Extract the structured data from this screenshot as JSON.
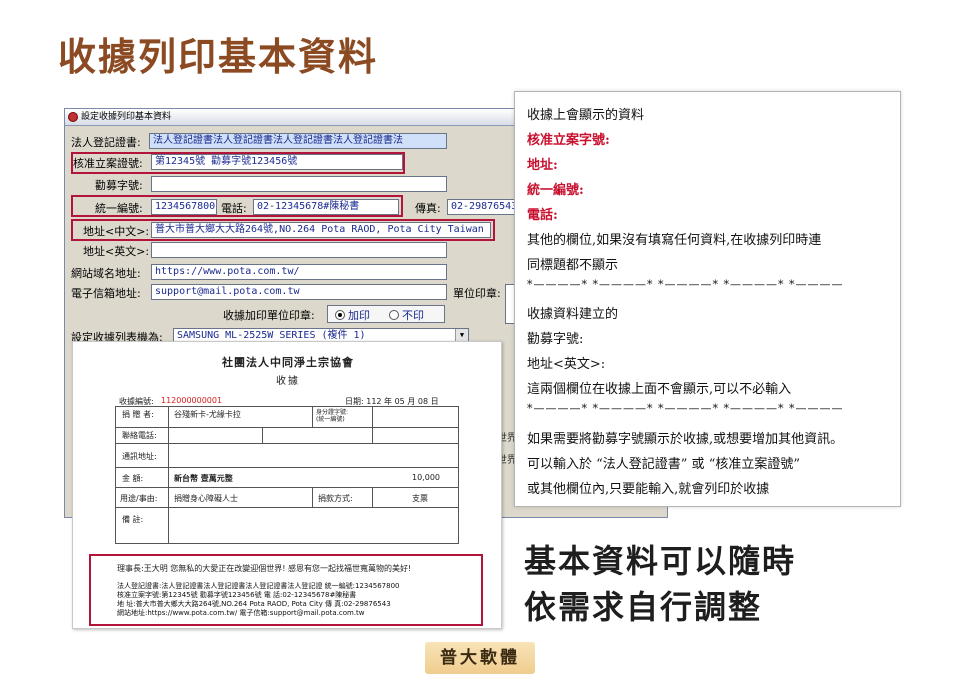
{
  "page": {
    "title": "收據列印基本資料"
  },
  "window": {
    "title": "設定收據列印基本資料",
    "labels": {
      "legal_cert": "法人登記證書:",
      "approval_no": "核准立案證號:",
      "fundraise_no": "勸募字號:",
      "tax_id": "統一編號:",
      "phone": "電話:",
      "fax": "傳真:",
      "address_zh": "地址<中文>:",
      "address_en": "地址<英文>:",
      "website": "網站域名地址:",
      "email": "電子信箱地址:",
      "unit_seal": "單位印章:",
      "seal_option": "收據加印單位印章:",
      "printer": "設定收據列表機為:"
    },
    "values": {
      "legal_cert": "法人登記證書法人登記證書法人登記證書法人登記證書法",
      "approval_no": "第12345號 勸募字號123456號",
      "fundraise_no": "",
      "tax_id": "1234567800",
      "phone": "02-12345678#陳秘書",
      "fax": "02-29876543",
      "address_zh": "普大市普大鄉大大路264號,NO.264 Pota RAOD, Pota City Taiwan",
      "address_en": "",
      "website": "https://www.pota.com.tw/",
      "email": "support@mail.pota.com.tw",
      "printer": "SAMSUNG ML-2525W SERIES (複件 1)"
    },
    "radio": {
      "yes": "加印",
      "no": "不印"
    },
    "edge_right": "世界",
    "edge_right2": "世界"
  },
  "receipt": {
    "org": "社團法人中同淨土宗協會",
    "name": "收據",
    "no_label": "收據編號:",
    "no_value": "112000000001",
    "date": "日期: 112 年 05 月 08 日",
    "donor_label": "捐 贈 者:",
    "donor_value": "谷殘新卡-尤緣卡拉",
    "id_label": "身分證字號:\n(統一編號)",
    "contact_label": "聯絡電話:",
    "address_label": "通訊地址:",
    "amount_label": "金  額:",
    "amount_words": "新台幣 壹萬元整",
    "amount_value": "10,000",
    "purpose_label": "用途/事由:",
    "purpose_value": "捐贈身心障礙人士",
    "method_label": "捐款方式:",
    "method_value": "支票",
    "remark_label": "備  註:",
    "director": "理事長:王大明    您無私的大愛正在改變迎個世界! 感恩有您一起找福世寬萬物的美好!",
    "footer": [
      "法人登記證書:法人登記證書法人登記證書法人登記證書法人登記證   統一編號:1234567800",
      "核准立案字號:第12345號 勸募字號123456號                         電    話:02-12345678#陳秘書",
      "地    址:普大市普大鄉大大路264號,NO.264 Pota RAOD, Pota City 傳    真:02-29876543",
      "網站地址:https://www.pota.com.tw/              電子信箱:support@mail.pota.com.tw"
    ]
  },
  "notes": {
    "lines": [
      "收據上會顯示的資料",
      "核准立案字號:",
      "地址:",
      "統一編號:",
      "電話:",
      "其他的欄位,如果沒有填寫任何資料,在收據列印時連",
      "同標題都不顯示",
      "*————* *————* *————* *————* *————",
      "收據資料建立的",
      "勸募字號:",
      "地址<英文>:",
      "這兩個欄位在收據上面不會顯示,可以不必輸入",
      "*————* *————* *————* *————* *————",
      "如果需要將勸募字號顯示於收據,或想要增加其他資訊。",
      "可以輸入於 “法人登記證書” 或 “核准立案證號”",
      "或其他欄位內,只要能輸入,就會列印於收據"
    ]
  },
  "tagline": {
    "line1": "基本資料可以隨時",
    "line2": "依需求自行調整"
  },
  "logo": {
    "text": "普大軟體"
  }
}
